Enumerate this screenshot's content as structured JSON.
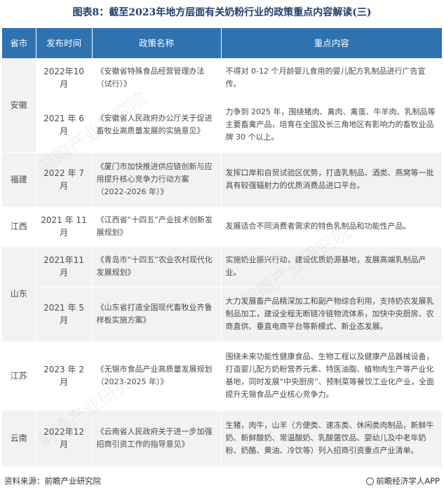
{
  "title": "图表8：截至2023年地方层面有关奶粉行业的政策重点内容解读(三)",
  "table": {
    "headers": [
      "省市",
      "发布时间",
      "政策名称",
      "重点内容"
    ],
    "rows": [
      {
        "province": "安徽",
        "date": "2022年10月",
        "name": "《安徽省特殊食品经营管理办法（试行）》",
        "key": "不得对 0-12 个月龄婴儿食用的婴儿配方乳制品进行广告宣传。"
      },
      {
        "province": "",
        "date": "2021 年 6 月",
        "name": "《安徽省人民政府办公厅关于促进畜牧业高质量发展的实施意见》",
        "key": "力争到 2025 年，围绕猪肉、禽肉、禽蛋、牛羊肉、乳制品等主要畜禽产品，培育在全国及长三角地区有影响力的畜牧业品牌 30 个以上。"
      },
      {
        "province": "福建",
        "date": "2022 年 7 月",
        "name": "《厦门市加快推进供应链创新与应用提升核心竞争力行动方案（2022-2026 年）》",
        "key": "发挥口岸和自贸试验区优势，打造乳制品、酒类、燕窝等一批具有较强辐射力的优质消费品进口平台。"
      },
      {
        "province": "江西",
        "date": "2021 年 11 月",
        "name": "《江西省“十四五”产业技术创新发展规划》",
        "key": "发展适合不同消费者需求的特色乳制品和功能性产品。"
      },
      {
        "province": "山东",
        "date": "2021年11月",
        "name": "《青岛市“十四五”农业农村现代化发展规划》",
        "key": "实施奶业振兴行动，建设优质奶源基地，发展高端乳制品产业。"
      },
      {
        "province": "",
        "date": "2021 年 5 月",
        "name": "《山东省打造全国现代畜牧业齐鲁样板实施方案》",
        "key": "大力发展畜产品精深加工和副产物综合利用，支持奶农发展乳制品加工，建设全程无断链冷链物流体系，加快中央厨房、农商直供、垂直电商平台等新模式、新业态发展。"
      },
      {
        "province": "江苏",
        "date": "2023 年 2 月",
        "name": "《无锡市食品产业高质量发展规划（2023-2025 年）》",
        "key": "围绕未来功能性健康食品、生物工程以及健康产品器械设备，打造婴儿配方奶粉营养元素、特医油脂、植物肉生产等产业化基地，同时发展“中央厨房”、预制菜等餐饮工业化产业，全面提升无锡食品产业核心竞争力。"
      },
      {
        "province": "云南",
        "date": "2022年12月",
        "name": "《云南省人民政府关于进一步加强招商引资工作的指导意见》",
        "key": "生猪，肉牛，山羊（方便类、速冻类、休闲类肉制品，新鲜牛奶、新鲜酸奶、常温酸奶、乳酸菌饮品、婴幼儿及中老年奶粉、奶酪、黄油、冷饮等）列入招商引资重点产业清单。"
      }
    ]
  },
  "footer": {
    "source": "资料来源：前瞻产业研究院",
    "app": "前瞻经济学人APP"
  },
  "watermark": "前瞻产业研究院",
  "colors": {
    "header_bg": "#2e72b0",
    "title": "#1f3f6e",
    "row_shade": "#f2f2f2"
  }
}
